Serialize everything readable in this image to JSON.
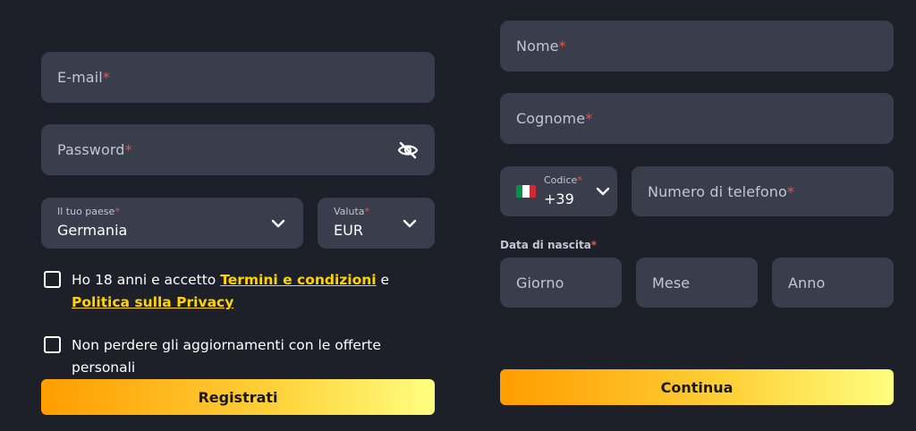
{
  "left": {
    "email": {
      "placeholder": "E-mail",
      "required": "*"
    },
    "password": {
      "placeholder": "Password",
      "required": "*",
      "toggle_icon": "eye-off-icon"
    },
    "country": {
      "label": "Il tuo paese",
      "required": "*",
      "value": "Germania"
    },
    "currency": {
      "label": "Valuta",
      "required": "*",
      "value": "EUR"
    },
    "terms": {
      "prefix": "Ho 18 anni e accetto ",
      "terms_link": "Termini e condizioni",
      "middle": " e ",
      "privacy_link": "Politica sulla Privacy"
    },
    "newsletter": {
      "text": "Non perdere gli aggiornamenti con le offerte personali"
    },
    "register_button": "Registrati"
  },
  "right": {
    "first_name": {
      "placeholder": "Nome",
      "required": "*"
    },
    "last_name": {
      "placeholder": "Cognome",
      "required": "*"
    },
    "phone_code": {
      "label": "Codice",
      "required": "*",
      "value": "+39",
      "flag": "italy-flag"
    },
    "phone_number": {
      "placeholder": "Numero di telefono",
      "required": "*"
    },
    "birth_date": {
      "label": "Data di nascita",
      "required": "*",
      "day": "Giorno",
      "month": "Mese",
      "year": "Anno"
    },
    "continue_button": "Continua"
  },
  "colors": {
    "background": "#1e2029",
    "field": "#3a3d4b",
    "required": "#e0574f",
    "link": "#ffd400",
    "button_gradient_start": "#ff9d00",
    "button_gradient_end": "#ffff80"
  }
}
